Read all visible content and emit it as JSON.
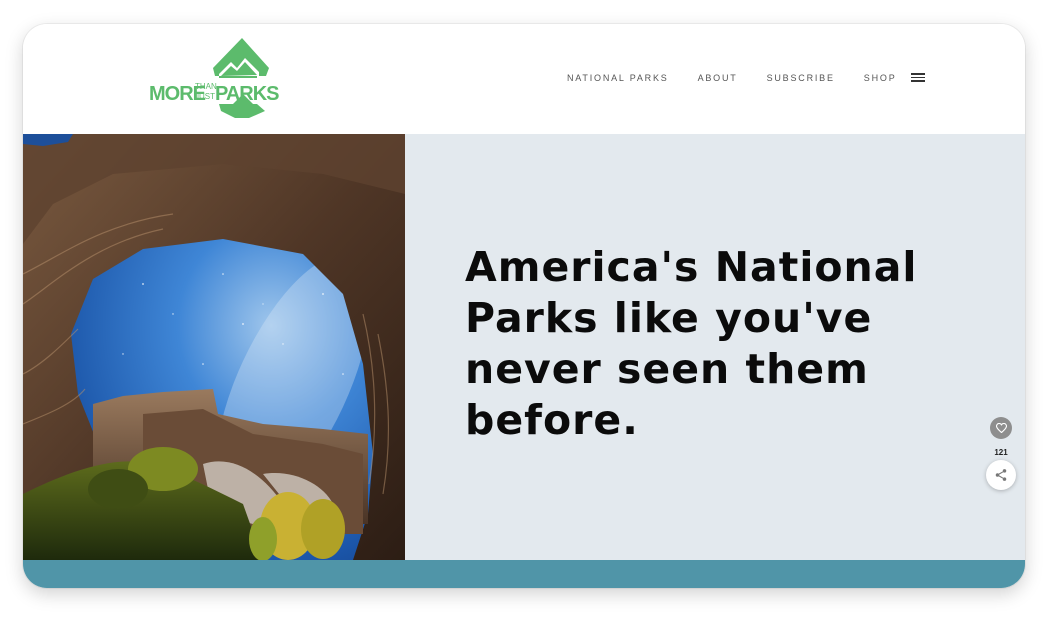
{
  "brand": {
    "logo_more": "MORE",
    "logo_than": "THAN",
    "logo_just": "JUST",
    "logo_parks": "PARKS",
    "color": "#5cbb6c"
  },
  "nav": {
    "items": [
      {
        "label": "NATIONAL PARKS"
      },
      {
        "label": "ABOUT"
      },
      {
        "label": "SUBSCRIBE"
      },
      {
        "label": "SHOP"
      }
    ],
    "menu_icon": "hamburger-icon"
  },
  "hero": {
    "image_alt_icon": "arch-night-sky-photo",
    "headline": "America's National Parks like you've never seen them before.",
    "panel_color": "#e3e9ee"
  },
  "share": {
    "like_icon": "heart-icon",
    "count": "121",
    "share_icon": "share-icon"
  },
  "colors": {
    "accent_band": "#5095a8"
  }
}
